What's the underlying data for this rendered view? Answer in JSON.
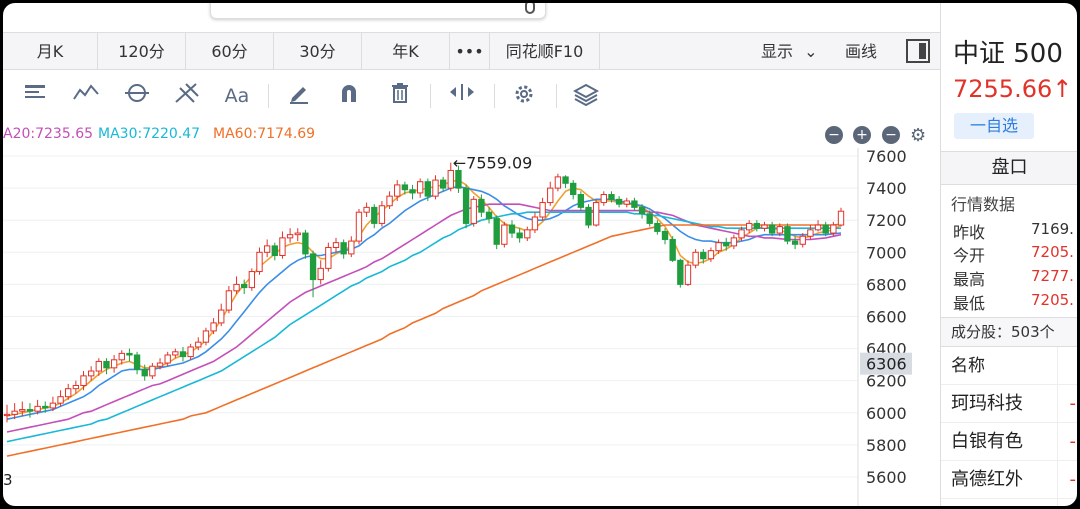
{
  "search": {
    "placeholder": ""
  },
  "periods": [
    {
      "label": "月K"
    },
    {
      "label": "120分"
    },
    {
      "label": "60分"
    },
    {
      "label": "30分"
    },
    {
      "label": "年K"
    },
    {
      "label": "•••"
    },
    {
      "label": "同花顺F10"
    }
  ],
  "period_right": {
    "display_label": "显示",
    "draw_label": "画线"
  },
  "toolbar_icons": [
    "indicator-icon",
    "line-draw-icon",
    "cycle-icon",
    "fork-icon",
    "font-icon",
    "pen-icon",
    "magnet-icon",
    "trash-icon",
    "fit-icon",
    "settings-icon",
    "layers-icon"
  ],
  "ma_labels": {
    "ma20": "A20:7235.65",
    "ma30": "MA30:7220.47",
    "ma60": "MA60:7174.69"
  },
  "colors": {
    "up": "#e0332a",
    "down": "#1f9d3f",
    "ma5": "#f0a030",
    "ma10": "#3a8ee6",
    "ma20": "#c44fb8",
    "ma30": "#19b8d6",
    "ma60": "#f07028"
  },
  "stock": {
    "name": "中证 500",
    "price": "7255.66↑",
    "watch_label": "一自选"
  },
  "pankou_label": "盘口",
  "market": {
    "title": "行情数据",
    "rows": [
      {
        "label": "昨收",
        "value": "7169.",
        "color": "#333333"
      },
      {
        "label": "今开",
        "value": "7205.",
        "color": "#e0332a"
      },
      {
        "label": "最高",
        "value": "7277.",
        "color": "#e0332a"
      },
      {
        "label": "最低",
        "value": "7205.",
        "color": "#e0332a"
      }
    ]
  },
  "constituents_label": "成分股：503个",
  "list": {
    "header": "名称",
    "items": [
      {
        "name": "珂玛科技"
      },
      {
        "name": "白银有色"
      },
      {
        "name": "高德红外"
      }
    ]
  },
  "chart_data": {
    "type": "line",
    "title": "",
    "ylim": [
      5500,
      7650
    ],
    "yticks": [
      5600,
      5800,
      6000,
      6200,
      6400,
      6600,
      6800,
      7000,
      7200,
      7400,
      7600
    ],
    "ytick_labels": [
      "5600",
      "5800",
      "6000",
      "6200",
      "6400",
      "6600",
      "6800",
      "7000",
      "7200",
      "7400",
      "7600"
    ],
    "crosshair_value": "6306",
    "peak_annotation": "←7559.09",
    "peak_value": 7559.09,
    "x_left_label": "3",
    "candles": [
      [
        5990,
        5990,
        6050,
        5940
      ],
      [
        5990,
        6010,
        6060,
        5960
      ],
      [
        6010,
        6020,
        6070,
        5980
      ],
      [
        6020,
        6010,
        6060,
        5970
      ],
      [
        6010,
        6040,
        6080,
        5990
      ],
      [
        6040,
        6030,
        6070,
        6000
      ],
      [
        6030,
        6060,
        6100,
        6010
      ],
      [
        6060,
        6100,
        6140,
        6040
      ],
      [
        6100,
        6150,
        6180,
        6080
      ],
      [
        6150,
        6170,
        6200,
        6120
      ],
      [
        6170,
        6230,
        6260,
        6140
      ],
      [
        6230,
        6260,
        6290,
        6200
      ],
      [
        6260,
        6320,
        6340,
        6230
      ],
      [
        6320,
        6280,
        6340,
        6240
      ],
      [
        6280,
        6330,
        6360,
        6250
      ],
      [
        6330,
        6370,
        6390,
        6300
      ],
      [
        6370,
        6360,
        6400,
        6320
      ],
      [
        6360,
        6270,
        6380,
        6240
      ],
      [
        6270,
        6230,
        6300,
        6200
      ],
      [
        6230,
        6290,
        6310,
        6210
      ],
      [
        6290,
        6310,
        6340,
        6270
      ],
      [
        6310,
        6360,
        6380,
        6290
      ],
      [
        6360,
        6380,
        6400,
        6340
      ],
      [
        6380,
        6350,
        6410,
        6320
      ],
      [
        6350,
        6410,
        6430,
        6330
      ],
      [
        6410,
        6440,
        6470,
        6390
      ],
      [
        6440,
        6510,
        6530,
        6420
      ],
      [
        6510,
        6560,
        6590,
        6490
      ],
      [
        6560,
        6640,
        6680,
        6540
      ],
      [
        6640,
        6760,
        6790,
        6620
      ],
      [
        6760,
        6800,
        6850,
        6740
      ],
      [
        6800,
        6780,
        6830,
        6740
      ],
      [
        6780,
        6880,
        6900,
        6760
      ],
      [
        6880,
        7000,
        7030,
        6860
      ],
      [
        7000,
        7040,
        7080,
        6970
      ],
      [
        7040,
        6980,
        7060,
        6950
      ],
      [
        6980,
        7090,
        7130,
        6960
      ],
      [
        7090,
        7110,
        7150,
        7060
      ],
      [
        7110,
        7120,
        7150,
        7070
      ],
      [
        7120,
        6990,
        7140,
        6960
      ],
      [
        6990,
        6830,
        7010,
        6720
      ],
      [
        6830,
        6900,
        6950,
        6800
      ],
      [
        6900,
        7030,
        7060,
        6880
      ],
      [
        7030,
        7060,
        7090,
        7000
      ],
      [
        7060,
        6990,
        7080,
        6960
      ],
      [
        6990,
        7070,
        7100,
        6970
      ],
      [
        7070,
        7250,
        7270,
        7050
      ],
      [
        7250,
        7280,
        7310,
        7220
      ],
      [
        7280,
        7180,
        7300,
        7150
      ],
      [
        7180,
        7290,
        7320,
        7160
      ],
      [
        7290,
        7350,
        7380,
        7270
      ],
      [
        7350,
        7420,
        7450,
        7320
      ],
      [
        7420,
        7390,
        7440,
        7360
      ],
      [
        7390,
        7370,
        7420,
        7330
      ],
      [
        7370,
        7440,
        7460,
        7340
      ],
      [
        7440,
        7350,
        7460,
        7320
      ],
      [
        7350,
        7450,
        7480,
        7330
      ],
      [
        7450,
        7400,
        7470,
        7380
      ],
      [
        7400,
        7510,
        7559,
        7380
      ],
      [
        7510,
        7400,
        7540,
        7370
      ],
      [
        7400,
        7180,
        7420,
        7150
      ],
      [
        7180,
        7330,
        7350,
        7160
      ],
      [
        7330,
        7250,
        7360,
        7220
      ],
      [
        7250,
        7210,
        7280,
        7180
      ],
      [
        7210,
        7050,
        7230,
        7020
      ],
      [
        7050,
        7170,
        7190,
        7030
      ],
      [
        7170,
        7120,
        7200,
        7090
      ],
      [
        7120,
        7090,
        7150,
        7060
      ],
      [
        7090,
        7140,
        7160,
        7070
      ],
      [
        7140,
        7220,
        7250,
        7120
      ],
      [
        7220,
        7310,
        7340,
        7200
      ],
      [
        7310,
        7400,
        7440,
        7290
      ],
      [
        7400,
        7470,
        7490,
        7380
      ],
      [
        7470,
        7430,
        7480,
        7400
      ],
      [
        7430,
        7360,
        7450,
        7330
      ],
      [
        7360,
        7280,
        7380,
        7260
      ],
      [
        7280,
        7170,
        7300,
        7150
      ],
      [
        7170,
        7310,
        7330,
        7160
      ],
      [
        7310,
        7360,
        7380,
        7290
      ],
      [
        7360,
        7330,
        7380,
        7310
      ],
      [
        7330,
        7300,
        7350,
        7280
      ],
      [
        7300,
        7320,
        7340,
        7280
      ],
      [
        7320,
        7280,
        7340,
        7260
      ],
      [
        7280,
        7240,
        7300,
        7210
      ],
      [
        7240,
        7180,
        7260,
        7160
      ],
      [
        7180,
        7130,
        7200,
        7110
      ],
      [
        7130,
        7080,
        7150,
        7050
      ],
      [
        7080,
        6950,
        7100,
        6940
      ],
      [
        6950,
        6800,
        6960,
        6780
      ],
      [
        6800,
        6920,
        6950,
        6790
      ],
      [
        6920,
        7000,
        7020,
        6900
      ],
      [
        7000,
        6960,
        7020,
        6930
      ],
      [
        6960,
        7010,
        7030,
        6940
      ],
      [
        7010,
        7060,
        7080,
        6990
      ],
      [
        7060,
        7040,
        7090,
        7010
      ],
      [
        7040,
        7090,
        7110,
        7020
      ],
      [
        7090,
        7140,
        7160,
        7070
      ],
      [
        7140,
        7180,
        7200,
        7120
      ],
      [
        7180,
        7150,
        7200,
        7130
      ],
      [
        7150,
        7170,
        7190,
        7130
      ],
      [
        7170,
        7120,
        7190,
        7100
      ],
      [
        7120,
        7160,
        7180,
        7100
      ],
      [
        7160,
        7070,
        7180,
        7050
      ],
      [
        7070,
        7050,
        7100,
        7020
      ],
      [
        7050,
        7100,
        7120,
        7030
      ],
      [
        7100,
        7140,
        7170,
        7080
      ],
      [
        7140,
        7170,
        7200,
        7130
      ],
      [
        7170,
        7120,
        7190,
        7100
      ],
      [
        7120,
        7170,
        7190,
        7100
      ],
      [
        7170,
        7256,
        7278,
        7160
      ]
    ],
    "series": [
      {
        "name": "MA5",
        "values": [
          5980,
          5990,
          6000,
          6010,
          6020,
          6030,
          6040,
          6060,
          6090,
          6120,
          6160,
          6200,
          6240,
          6270,
          6290,
          6310,
          6320,
          6300,
          6280,
          6280,
          6290,
          6310,
          6340,
          6360,
          6380,
          6410,
          6450,
          6510,
          6580,
          6660,
          6740,
          6800,
          6850,
          6910,
          6950,
          6990,
          7030,
          7050,
          7060,
          7050,
          7000,
          6960,
          6960,
          6990,
          7010,
          7040,
          7100,
          7170,
          7220,
          7260,
          7300,
          7340,
          7370,
          7380,
          7390,
          7400,
          7410,
          7420,
          7440,
          7450,
          7420,
          7370,
          7330,
          7280,
          7220,
          7180,
          7160,
          7150,
          7130,
          7150,
          7190,
          7250,
          7320,
          7380,
          7400,
          7390,
          7350,
          7320,
          7320,
          7320,
          7310,
          7300,
          7300,
          7280,
          7250,
          7210,
          7160,
          7080,
          6980,
          6940,
          6930,
          6940,
          6960,
          7000,
          7020,
          7050,
          7090,
          7120,
          7150,
          7160,
          7150,
          7140,
          7120,
          7100,
          7090,
          7100,
          7120,
          7130,
          7140,
          7170
        ]
      },
      {
        "name": "MA10",
        "values": [
          5960,
          5970,
          5980,
          5990,
          6000,
          6010,
          6020,
          6040,
          6060,
          6080,
          6100,
          6130,
          6170,
          6200,
          6230,
          6260,
          6270,
          6270,
          6270,
          6270,
          6280,
          6290,
          6300,
          6310,
          6330,
          6350,
          6380,
          6420,
          6460,
          6510,
          6570,
          6630,
          6690,
          6750,
          6800,
          6840,
          6880,
          6920,
          6950,
          6970,
          6980,
          6980,
          6990,
          7000,
          7010,
          7020,
          7040,
          7080,
          7110,
          7150,
          7180,
          7220,
          7260,
          7290,
          7320,
          7340,
          7360,
          7380,
          7400,
          7410,
          7400,
          7390,
          7380,
          7360,
          7330,
          7290,
          7260,
          7230,
          7210,
          7200,
          7200,
          7210,
          7230,
          7260,
          7290,
          7310,
          7320,
          7330,
          7330,
          7330,
          7320,
          7310,
          7300,
          7290,
          7270,
          7240,
          7210,
          7170,
          7130,
          7100,
          7080,
          7070,
          7070,
          7060,
          7060,
          7060,
          7070,
          7080,
          7100,
          7110,
          7110,
          7110,
          7110,
          7110,
          7110,
          7110,
          7110,
          7110,
          7115,
          7120
        ]
      },
      {
        "name": "MA20",
        "values": [
          5880,
          5890,
          5900,
          5910,
          5920,
          5930,
          5940,
          5950,
          5960,
          5980,
          6000,
          6010,
          6030,
          6050,
          6070,
          6090,
          6110,
          6130,
          6150,
          6170,
          6180,
          6200,
          6220,
          6240,
          6260,
          6280,
          6300,
          6320,
          6350,
          6380,
          6410,
          6450,
          6490,
          6530,
          6570,
          6610,
          6650,
          6690,
          6720,
          6750,
          6770,
          6790,
          6810,
          6830,
          6850,
          6870,
          6890,
          6910,
          6940,
          6960,
          6990,
          7020,
          7050,
          7080,
          7110,
          7140,
          7170,
          7200,
          7230,
          7250,
          7270,
          7280,
          7290,
          7300,
          7300,
          7300,
          7300,
          7300,
          7290,
          7280,
          7270,
          7260,
          7260,
          7260,
          7260,
          7260,
          7260,
          7260,
          7260,
          7260,
          7260,
          7260,
          7260,
          7260,
          7250,
          7250,
          7240,
          7230,
          7210,
          7190,
          7170,
          7160,
          7150,
          7140,
          7130,
          7120,
          7110,
          7100,
          7100,
          7090,
          7090,
          7085,
          7080,
          7080,
          7080,
          7080,
          7085,
          7090,
          7100,
          7110
        ]
      },
      {
        "name": "MA30",
        "values": [
          5820,
          5830,
          5840,
          5850,
          5860,
          5870,
          5880,
          5890,
          5900,
          5910,
          5920,
          5930,
          5950,
          5960,
          5980,
          6000,
          6020,
          6040,
          6060,
          6080,
          6100,
          6120,
          6140,
          6160,
          6180,
          6200,
          6220,
          6240,
          6260,
          6290,
          6320,
          6350,
          6380,
          6410,
          6440,
          6470,
          6510,
          6550,
          6580,
          6610,
          6640,
          6670,
          6700,
          6730,
          6760,
          6790,
          6810,
          6840,
          6860,
          6880,
          6910,
          6930,
          6950,
          6980,
          7000,
          7030,
          7060,
          7090,
          7110,
          7140,
          7160,
          7180,
          7200,
          7210,
          7220,
          7230,
          7240,
          7240,
          7250,
          7250,
          7250,
          7250,
          7250,
          7250,
          7250,
          7250,
          7250,
          7250,
          7250,
          7250,
          7250,
          7250,
          7240,
          7240,
          7230,
          7230,
          7220,
          7210,
          7200,
          7190,
          7180,
          7170,
          7160,
          7160,
          7150,
          7150,
          7150,
          7150,
          7150,
          7150,
          7150,
          7150,
          7150,
          7150,
          7150,
          7150,
          7150,
          7150,
          7150,
          7150
        ]
      },
      {
        "name": "MA60",
        "values": [
          5730,
          5740,
          5750,
          5760,
          5770,
          5780,
          5790,
          5800,
          5810,
          5820,
          5830,
          5840,
          5850,
          5860,
          5870,
          5880,
          5890,
          5900,
          5910,
          5920,
          5930,
          5940,
          5950,
          5960,
          5980,
          5990,
          6000,
          6020,
          6040,
          6060,
          6080,
          6100,
          6120,
          6140,
          6160,
          6180,
          6200,
          6220,
          6240,
          6260,
          6280,
          6300,
          6320,
          6340,
          6360,
          6380,
          6400,
          6420,
          6440,
          6460,
          6490,
          6510,
          6530,
          6560,
          6580,
          6600,
          6620,
          6650,
          6670,
          6690,
          6710,
          6730,
          6760,
          6780,
          6800,
          6820,
          6840,
          6860,
          6880,
          6900,
          6920,
          6940,
          6960,
          6980,
          7000,
          7020,
          7040,
          7060,
          7080,
          7100,
          7110,
          7120,
          7130,
          7140,
          7150,
          7160,
          7170,
          7170,
          7170,
          7170,
          7170,
          7170,
          7170,
          7170,
          7170,
          7170,
          7170,
          7170,
          7170,
          7170,
          7170,
          7170,
          7170,
          7170,
          7170,
          7170,
          7170,
          7170,
          7170,
          7175
        ]
      }
    ]
  }
}
